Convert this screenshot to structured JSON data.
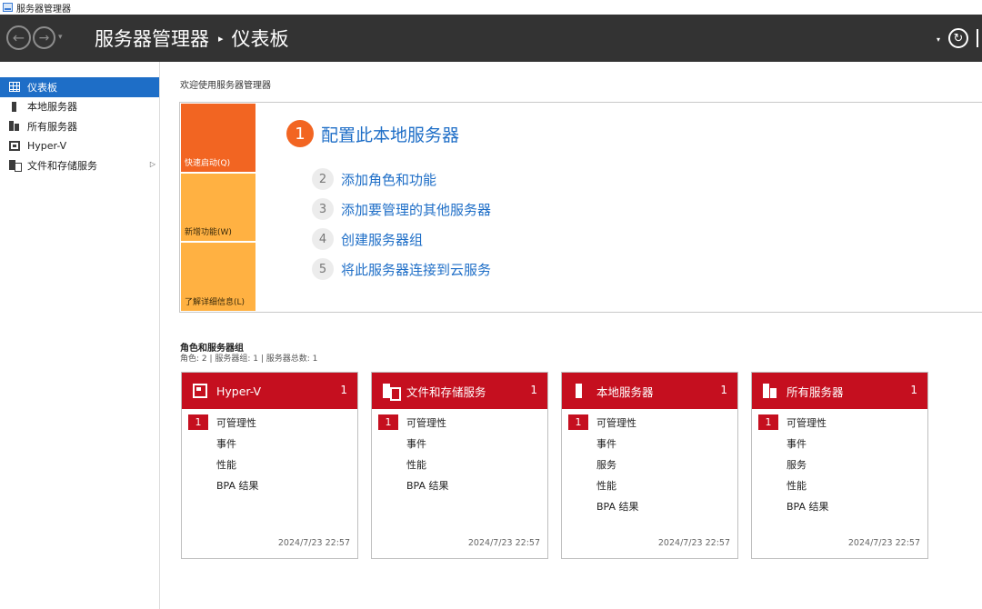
{
  "window": {
    "title": "服务器管理器"
  },
  "header": {
    "breadcrumb_root": "服务器管理器",
    "breadcrumb_sep": "▸",
    "breadcrumb_page": "仪表板",
    "back_glyph": "←",
    "forward_glyph": "→",
    "refresh_glyph": "↻"
  },
  "sidebar": {
    "items": [
      {
        "label": "仪表板",
        "icon": "dashboard-grid-icon",
        "active": true
      },
      {
        "label": "本地服务器",
        "icon": "server-icon"
      },
      {
        "label": "所有服务器",
        "icon": "servers-icon"
      },
      {
        "label": "Hyper-V",
        "icon": "hyperv-icon"
      },
      {
        "label": "文件和存储服务",
        "icon": "file-storage-icon",
        "expandable": true
      }
    ]
  },
  "main": {
    "welcome": "欢迎使用服务器管理器",
    "quick_tabs": [
      "快速启动(Q)",
      "新增功能(W)",
      "了解详细信息(L)"
    ],
    "steps": [
      {
        "num": "1",
        "label": "配置此本地服务器"
      },
      {
        "num": "2",
        "label": "添加角色和功能"
      },
      {
        "num": "3",
        "label": "添加要管理的其他服务器"
      },
      {
        "num": "4",
        "label": "创建服务器组"
      },
      {
        "num": "5",
        "label": "将此服务器连接到云服务"
      }
    ],
    "roles_title": "角色和服务器组",
    "roles_subtitle": "角色: 2 | 服务器组: 1 | 服务器总数: 1",
    "tiles": [
      {
        "name": "Hyper-V",
        "count": "1",
        "icon": "hyperv-icon",
        "rows": [
          {
            "badge": "1",
            "label": "可管理性"
          },
          {
            "label": "事件"
          },
          {
            "label": "性能"
          },
          {
            "label": "BPA 结果"
          }
        ],
        "date": "2024/7/23 22:57"
      },
      {
        "name": "文件和存储服务",
        "count": "1",
        "icon": "file-storage-icon",
        "rows": [
          {
            "badge": "1",
            "label": "可管理性"
          },
          {
            "label": "事件"
          },
          {
            "label": "性能"
          },
          {
            "label": "BPA 结果"
          }
        ],
        "date": "2024/7/23 22:57"
      },
      {
        "name": "本地服务器",
        "count": "1",
        "icon": "server-icon",
        "rows": [
          {
            "badge": "1",
            "label": "可管理性"
          },
          {
            "label": "事件"
          },
          {
            "label": "服务"
          },
          {
            "label": "性能"
          },
          {
            "label": "BPA 结果"
          }
        ],
        "date": "2024/7/23 22:57"
      },
      {
        "name": "所有服务器",
        "count": "1",
        "icon": "servers-icon",
        "rows": [
          {
            "badge": "1",
            "label": "可管理性"
          },
          {
            "label": "事件"
          },
          {
            "label": "服务"
          },
          {
            "label": "性能"
          },
          {
            "label": "BPA 结果"
          }
        ],
        "date": "2024/7/23 22:57"
      }
    ]
  }
}
